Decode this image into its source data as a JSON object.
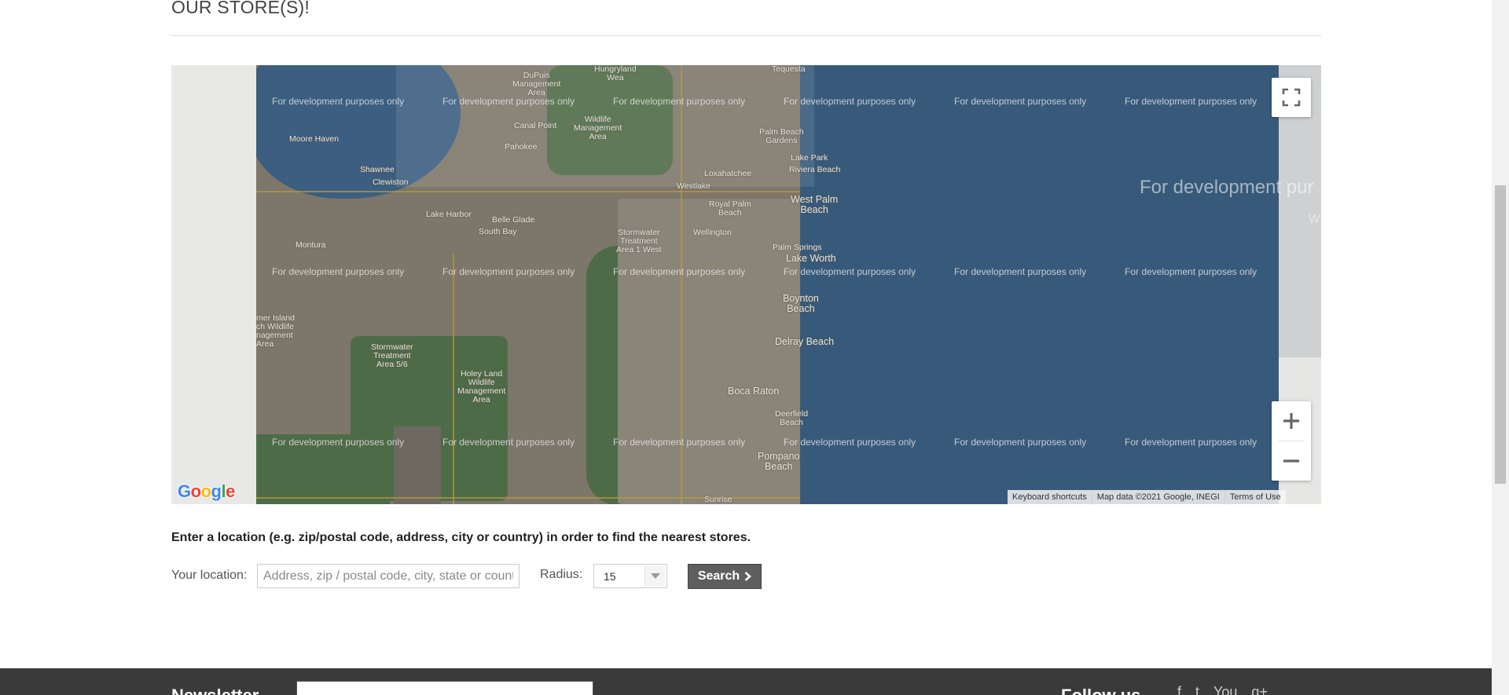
{
  "page": {
    "title": "OUR STORE(S)!"
  },
  "map": {
    "dev_watermark": "For development purposes only",
    "dev_watermark_large": "For development pur",
    "dev_watermark_large_2": "w",
    "places": {
      "dupuis": "DuPuis\nManagement\nArea",
      "hungryland": "Hungryland\nWea",
      "tequesta": "Tequesta",
      "moore_haven": "Moore Haven",
      "canal_point": "Canal Point",
      "pahokee": "Pahokee",
      "jwcorbett": "Wildlife\nManagement\nArea",
      "palm_beach_gardens": "Palm Beach\nGardens",
      "lake_park": "Lake Park",
      "riviera_beach": "Riviera Beach",
      "shawnee": "Shawnee",
      "clewiston": "Clewiston",
      "loxahatchee": "Loxahatchee",
      "westlake": "Westlake",
      "royal_palm_beach": "Royal Palm\nBeach",
      "west_palm_beach": "West Palm\nBeach",
      "lake_harbor": "Lake Harbor",
      "belle_glade": "Belle Glade",
      "south_bay": "South Bay",
      "stormwater_1w": "Stormwater\nTreatment\nArea 1 West",
      "wellington": "Wellington",
      "palm_springs": "Palm Springs",
      "lake_worth": "Lake Worth",
      "montura": "Montura",
      "boynton_beach": "Boynton\nBeach",
      "pine_island": "mer Island\nch Wildlife\nnagement\nArea",
      "stormwater_56": "Stormwater\nTreatment\nArea 5/6",
      "delray_beach": "Delray Beach",
      "holey_land": "Holey Land\nWildlife\nManagement\nArea",
      "boca_raton": "Boca Raton",
      "deerfield_beach": "Deerfield\nBeach",
      "pompano_beach": "Pompano\nBeach",
      "sunrise": "Sunrise"
    },
    "attribution": {
      "keyboard": "Keyboard shortcuts",
      "data": "Map data ©2021 Google, INEGI",
      "terms": "Terms of Use"
    },
    "logo": [
      "G",
      "o",
      "o",
      "g",
      "l",
      "e"
    ],
    "logo_colors": [
      "#4285F4",
      "#EA4335",
      "#FBBC05",
      "#4285F4",
      "#34A853",
      "#EA4335"
    ]
  },
  "search": {
    "instructions": "Enter a location (e.g. zip/postal code, address, city or country) in order to find the nearest stores.",
    "location_label": "Your location:",
    "location_placeholder": "Address, zip / postal code, city, state or country",
    "radius_label": "Radius:",
    "radius_value": "15",
    "search_label": "Search",
    "search_icon": "chevron-right-icon"
  },
  "footer": {
    "newsletter_title": "Newsletter",
    "follow_title": "Follow us",
    "social_icons": [
      "facebook-icon",
      "twitter-icon",
      "youtube-icon",
      "google-plus-icon"
    ],
    "social_glyphs": [
      "f",
      "t",
      "You",
      "g+"
    ]
  }
}
